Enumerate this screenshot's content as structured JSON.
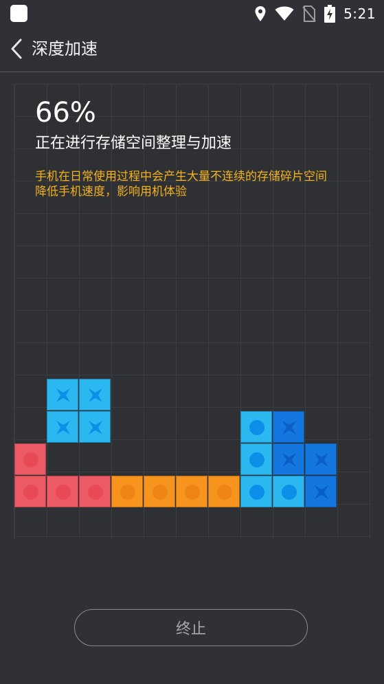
{
  "status_bar": {
    "time": "5:21",
    "icons": [
      "app-icon",
      "location-icon",
      "wifi-icon",
      "no-sim-icon",
      "battery-charging-icon"
    ]
  },
  "header": {
    "back_icon": "chevron-left-icon",
    "title": "深度加速"
  },
  "progress": {
    "percent": "66%",
    "status": "正在进行存储空间整理与加速"
  },
  "tip": {
    "line1": "手机在日常使用过程中会产生大量不连续的存储碎片空间",
    "line2": "降低手机速度，影响用机体验"
  },
  "blocks": {
    "colors": {
      "red": "#ec5b65",
      "orange": "#f7941d",
      "light_blue": "#2bb7ef",
      "dark_blue": "#1477e0"
    }
  },
  "footer": {
    "stop_label": "终止"
  },
  "colors": {
    "background": "#2f3136",
    "tip": "#f4b21c",
    "text": "#ffffff"
  }
}
